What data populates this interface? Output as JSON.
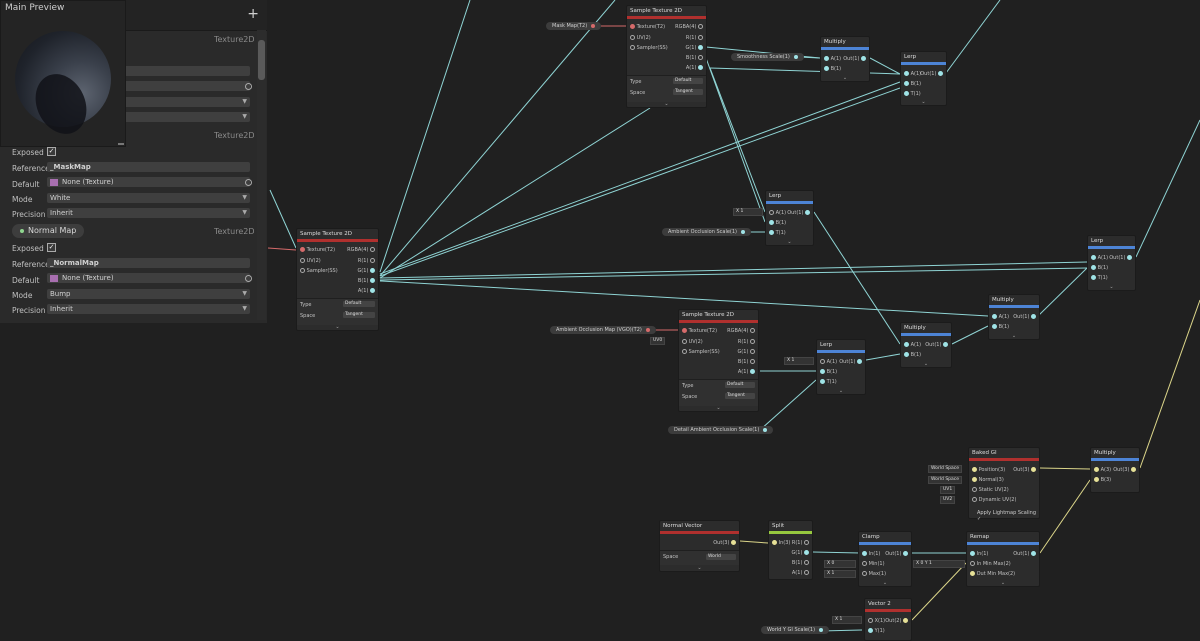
{
  "blackboard": {
    "add_label": "+",
    "preview_title": "Main Preview",
    "type_label": "Texture2D",
    "mask_section": {
      "type_label": "Texture2D",
      "rows": [
        {
          "label": "Exposed",
          "value": "✓"
        },
        {
          "label": "Reference",
          "value": "_MaskMap"
        },
        {
          "label": "Default",
          "value": "None (Texture)"
        },
        {
          "label": "Mode",
          "value": "White"
        },
        {
          "label": "Precision",
          "value": "Inherit"
        }
      ]
    },
    "normal_section": {
      "name": "Normal Map",
      "type_label": "Texture2D",
      "rows": [
        {
          "label": "Exposed",
          "value": "✓"
        },
        {
          "label": "Reference",
          "value": "_NormalMap"
        },
        {
          "label": "Default",
          "value": "None (Texture)"
        },
        {
          "label": "Mode",
          "value": "Bump"
        },
        {
          "label": "Precision",
          "value": "Inherit"
        }
      ]
    }
  },
  "nodes": {
    "sample1": {
      "title": "Sample Texture 2D",
      "inputs": [
        "Texture(T2)",
        "UV(2)",
        "Sampler(SS)"
      ],
      "outputs": [
        "RGBA(4)",
        "R(1)",
        "G(1)",
        "B(1)",
        "A(1)"
      ],
      "type_label": "Type",
      "type_value": "Default",
      "space_label": "Space",
      "space_value": "Tangent"
    },
    "sample2": {
      "title": "Sample Texture 2D",
      "inputs": [
        "Texture(T2)",
        "UV(2)",
        "Sampler(SS)"
      ],
      "outputs": [
        "RGBA(4)",
        "R(1)",
        "G(1)",
        "B(1)",
        "A(1)"
      ],
      "type_label": "Type",
      "type_value": "Default",
      "space_label": "Space",
      "space_value": "Tangent"
    },
    "sample3": {
      "title": "Sample Texture 2D",
      "inputs": [
        "Texture(T2)",
        "UV(2)",
        "Sampler(SS)"
      ],
      "outputs": [
        "RGBA(4)",
        "R(1)",
        "G(1)",
        "B(1)",
        "A(1)"
      ],
      "type_label": "Type",
      "type_value": "Default",
      "space_label": "Space",
      "space_value": "Tangent",
      "uv_value": "UV0"
    },
    "multiply1": {
      "title": "Multiply",
      "inputs": [
        "A(1)",
        "B(1)"
      ],
      "output": "Out(1)"
    },
    "lerp1": {
      "title": "Lerp",
      "inputs": [
        "A(1)",
        "B(1)",
        "T(1)"
      ],
      "output": "Out(1)"
    },
    "lerp2": {
      "title": "Lerp",
      "inputs": [
        "A(1)",
        "B(1)",
        "T(1)"
      ],
      "output": "Out(1)",
      "x_label": "X",
      "x_value": "1"
    },
    "lerp3": {
      "title": "Lerp",
      "inputs": [
        "A(1)",
        "B(1)",
        "T(1)"
      ],
      "output": "Out(1)"
    },
    "multiply2": {
      "title": "Multiply",
      "inputs": [
        "A(1)",
        "B(1)"
      ],
      "output": "Out(1)"
    },
    "multiply3": {
      "title": "Multiply",
      "inputs": [
        "A(1)",
        "B(1)"
      ],
      "output": "Out(1)"
    },
    "lerp4": {
      "title": "Lerp",
      "inputs": [
        "A(1)",
        "B(1)",
        "T(1)"
      ],
      "output": "Out(1)",
      "x_label": "X",
      "x_value": "1"
    },
    "baked_gi": {
      "title": "Baked GI",
      "inputs": [
        "Position(3)",
        "Normal(3)",
        "Static UV(2)",
        "Dynamic UV(2)"
      ],
      "output": "Out(3)",
      "input_values": [
        "World Space",
        "World Space",
        "UV1",
        "UV2"
      ],
      "apply_label": "Apply Lightmap Scaling",
      "apply_check": "✓"
    },
    "multiply4": {
      "title": "Multiply",
      "inputs": [
        "A(3)",
        "B(3)"
      ],
      "output": "Out(3)"
    },
    "normal_vector": {
      "title": "Normal Vector",
      "output": "Out(3)",
      "space_label": "Space",
      "space_value": "World"
    },
    "split": {
      "title": "Split",
      "input": "In(3)",
      "outputs": [
        "R(1)",
        "G(1)",
        "B(1)",
        "A(1)"
      ]
    },
    "clamp": {
      "title": "Clamp",
      "inputs": [
        "In(1)",
        "Min(1)",
        "Max(1)"
      ],
      "output": "Out(1)",
      "min_label": "X",
      "min_value": "0",
      "max_label": "X",
      "max_value": "1"
    },
    "remap": {
      "title": "Remap",
      "inputs": [
        "In(1)",
        "In Min Max(2)",
        "Out Min Max(2)"
      ],
      "output": "Out(1)",
      "x_label": "X",
      "x_value": "0",
      "y_label": "Y",
      "y_value": "1"
    },
    "vector2": {
      "title": "Vector 2",
      "inputs": [
        "X(1)",
        "Y(1)"
      ],
      "output": "Out(2)",
      "x_label": "X",
      "x_value": "1"
    }
  },
  "properties": {
    "mask_map": "Mask Map(T2)",
    "smoothness_scale": "Smoothness Scale(1)",
    "ambient_occlusion_scale": "Ambient Occlusion Scale(1)",
    "ao_map": "Ambient Occlusion Map (VGO)(T2)",
    "detail_ao_scale": "Detail Ambient Occlusion Scale(1)",
    "world_y_gi_scale": "World Y GI Scale(1)"
  },
  "colors": {
    "texture_port": "#d56a6a",
    "float_port": "#9fe3e6",
    "vector3_port": "#e6e097",
    "header_red": "#b0302e",
    "header_blue": "#4d84d6",
    "header_green": "#97c93f",
    "wire_cyan": "#8fd4d4",
    "wire_yellow": "#dcd68a"
  }
}
